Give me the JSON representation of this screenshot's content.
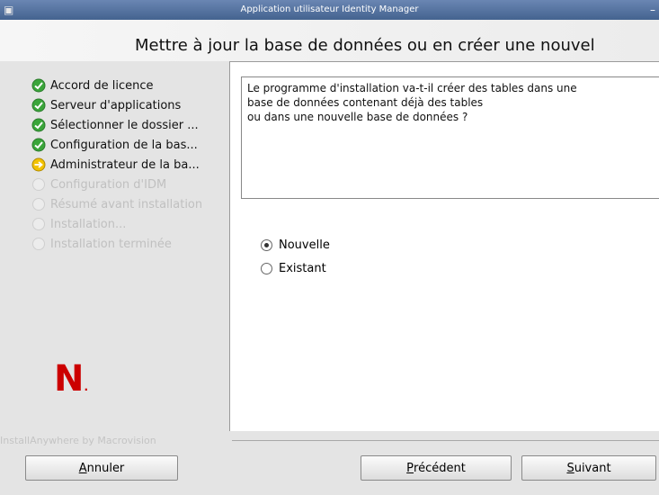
{
  "window": {
    "title": "Application utilisateur Identity Manager",
    "min_icon": "–"
  },
  "header": {
    "title": "Mettre à jour la base de données ou en créer une nouvel"
  },
  "steps": [
    {
      "label": "Accord de licence",
      "state": "done",
      "icon": "check-icon"
    },
    {
      "label": "Serveur d'applications",
      "state": "done",
      "icon": "check-icon"
    },
    {
      "label": "Sélectionner le dossier ...",
      "state": "done",
      "icon": "check-icon"
    },
    {
      "label": "Configuration de la bas...",
      "state": "done",
      "icon": "check-icon"
    },
    {
      "label": "Administrateur de la ba...",
      "state": "current",
      "icon": "arrow-icon"
    },
    {
      "label": "Configuration d'IDM",
      "state": "pending",
      "icon": "pending-icon"
    },
    {
      "label": "Résumé avant installation",
      "state": "pending",
      "icon": "pending-icon"
    },
    {
      "label": "Installation...",
      "state": "pending",
      "icon": "pending-icon"
    },
    {
      "label": "Installation terminée",
      "state": "pending",
      "icon": "pending-icon"
    }
  ],
  "logo": {
    "letter": "N",
    "dot": "."
  },
  "main": {
    "question": "Le programme d'installation va-t-il créer des tables dans une\nbase de données contenant déjà des tables\nou dans une nouvelle base de données ?",
    "options": [
      {
        "label": "Nouvelle",
        "selected": true
      },
      {
        "label": "Existant",
        "selected": false
      }
    ]
  },
  "footer": {
    "vendor": "InstallAnywhere by Macrovision",
    "cancel_mnemonic": "A",
    "cancel_rest": "nnuler",
    "prev_mnemonic": "P",
    "prev_rest": "récédent",
    "next_mnemonic": "S",
    "next_rest": "uivant"
  },
  "colors": {
    "check": "#3aa53a",
    "arrow": "#e0b000",
    "logo": "#cc0000",
    "titlebar": "#5676a8"
  }
}
